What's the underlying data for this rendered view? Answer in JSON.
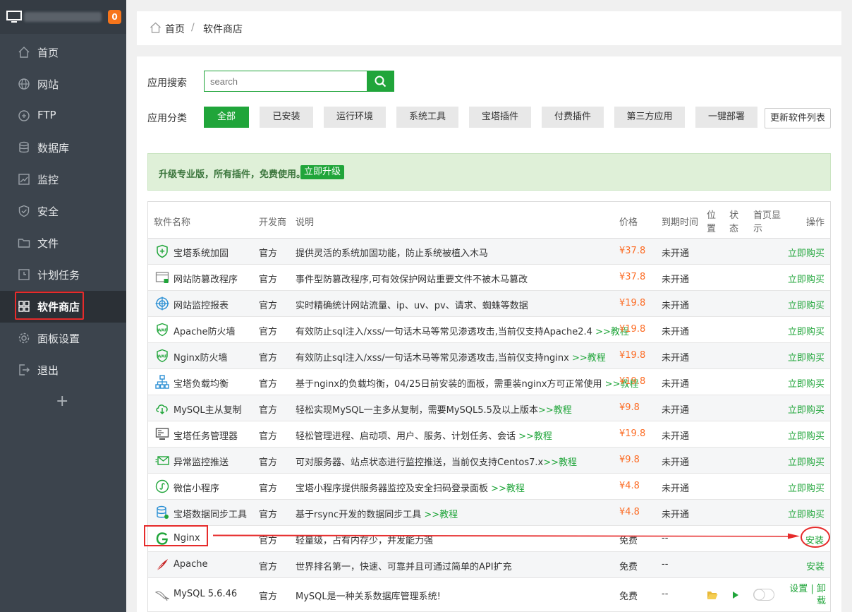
{
  "sidebar": {
    "badge": "0",
    "items": [
      {
        "label": "首页",
        "icon": "home-icon"
      },
      {
        "label": "网站",
        "icon": "globe-icon"
      },
      {
        "label": "FTP",
        "icon": "ftp-icon"
      },
      {
        "label": "数据库",
        "icon": "database-icon"
      },
      {
        "label": "监控",
        "icon": "monitor-chart-icon"
      },
      {
        "label": "安全",
        "icon": "shield-icon"
      },
      {
        "label": "文件",
        "icon": "folder-icon"
      },
      {
        "label": "计划任务",
        "icon": "clock-icon"
      },
      {
        "label": "软件商店",
        "icon": "apps-grid-icon"
      },
      {
        "label": "面板设置",
        "icon": "gear-icon"
      },
      {
        "label": "退出",
        "icon": "logout-icon"
      }
    ],
    "add_label": "+"
  },
  "breadcrumb": {
    "home": "首页",
    "sep": "/",
    "current": "软件商店"
  },
  "search": {
    "label": "应用搜索",
    "placeholder": "search"
  },
  "categories": {
    "label": "应用分类",
    "items": [
      "全部",
      "已安装",
      "运行环境",
      "系统工具",
      "宝塔插件",
      "付费插件",
      "第三方应用",
      "一键部署"
    ],
    "refresh": "更新软件列表"
  },
  "upgrade": {
    "text": "升级专业版，所有插件，免费使用。",
    "button": "立即升级"
  },
  "table": {
    "headers": {
      "name": "软件名称",
      "dev": "开发商",
      "desc": "说明",
      "price": "价格",
      "expire": "到期时间",
      "pos1": "位",
      "pos2": "置",
      "st1": "状",
      "st2": "态",
      "home1": "首页显",
      "home2": "示",
      "op": "操作"
    },
    "rows": [
      {
        "name": "宝塔系统加固",
        "dev": "官方",
        "desc": "提供灵活的系统加固功能，防止系统被植入木马",
        "link": "",
        "price": "¥37.8",
        "expire": "未开通",
        "op": "立即购买"
      },
      {
        "name": "网站防篡改程序",
        "dev": "官方",
        "desc": "事件型防篡改程序,可有效保护网站重要文件不被木马篡改",
        "link": "",
        "price": "¥37.8",
        "expire": "未开通",
        "op": "立即购买"
      },
      {
        "name": "网站监控报表",
        "dev": "官方",
        "desc": "实时精确统计网站流量、ip、uv、pv、请求、蜘蛛等数据",
        "link": "",
        "price": "¥19.8",
        "expire": "未开通",
        "op": "立即购买"
      },
      {
        "name": "Apache防火墙",
        "dev": "官方",
        "desc": "有效防止sql注入/xss/一句话木马等常见渗透攻击,当前仅支持Apache2.4 ",
        "link": ">>教程",
        "price": "¥19.8",
        "expire": "未开通",
        "op": "立即购买"
      },
      {
        "name": "Nginx防火墙",
        "dev": "官方",
        "desc": "有效防止sql注入/xss/一句话木马等常见渗透攻击,当前仅支持nginx ",
        "link": ">>教程",
        "price": "¥19.8",
        "expire": "未开通",
        "op": "立即购买"
      },
      {
        "name": "宝塔负载均衡",
        "dev": "官方",
        "desc": "基于nginx的负载均衡，04/25日前安装的面板，需重装nginx方可正常使用 ",
        "link": ">>教程",
        "price": "¥19.8",
        "expire": "未开通",
        "op": "立即购买"
      },
      {
        "name": "MySQL主从复制",
        "dev": "官方",
        "desc": "轻松实现MySQL一主多从复制，需要MySQL5.5及以上版本",
        "link": ">>教程",
        "price": "¥9.8",
        "expire": "未开通",
        "op": "立即购买"
      },
      {
        "name": "宝塔任务管理器",
        "dev": "官方",
        "desc": "轻松管理进程、启动项、用户、服务、计划任务、会话 ",
        "link": ">>教程",
        "price": "¥19.8",
        "expire": "未开通",
        "op": "立即购买"
      },
      {
        "name": "异常监控推送",
        "dev": "官方",
        "desc": "可对服务器、站点状态进行监控推送，当前仅支持Centos7.x",
        "link": ">>教程",
        "price": "¥9.8",
        "expire": "未开通",
        "op": "立即购买"
      },
      {
        "name": "微信小程序",
        "dev": "官方",
        "desc": "宝塔小程序提供服务器监控及安全扫码登录面板 ",
        "link": ">>教程",
        "price": "¥4.8",
        "expire": "未开通",
        "op": "立即购买"
      },
      {
        "name": "宝塔数据同步工具",
        "dev": "官方",
        "desc": "基于rsync开发的数据同步工具 ",
        "link": ">>教程",
        "price": "¥4.8",
        "expire": "未开通",
        "op": "立即购买"
      },
      {
        "name": "Nginx",
        "dev": "官方",
        "desc": "轻量级，占有内存少，并发能力强",
        "link": "",
        "price": "免费",
        "expire": "--",
        "op": "安装"
      },
      {
        "name": "Apache",
        "dev": "官方",
        "desc": "世界排名第一，快速、可靠并且可通过简单的API扩充",
        "link": "",
        "price": "免费",
        "expire": "--",
        "op": "安装"
      },
      {
        "name": "MySQL 5.6.46",
        "dev": "官方",
        "desc": "MySQL是一种关系数据库管理系统!",
        "link": "",
        "price": "免费",
        "expire": "--",
        "op1": "设置",
        "opsep": "|",
        "op2": "卸",
        "op3": "载"
      }
    ]
  },
  "colors": {
    "accent": "#20a53a",
    "price": "#fc6d26",
    "sidebar": "#3c444d",
    "annotation": "#e62b2b"
  }
}
